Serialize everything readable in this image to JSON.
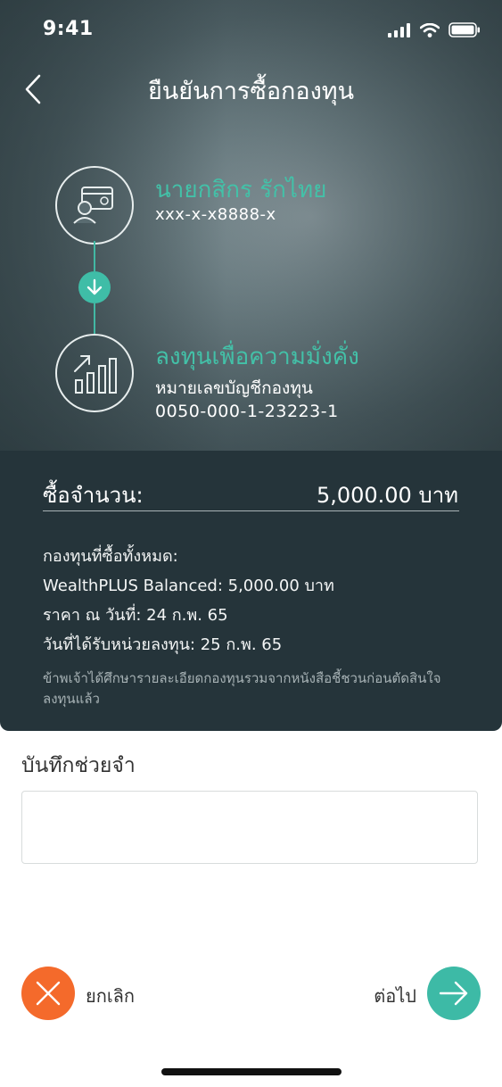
{
  "status_bar": {
    "time": "9:41"
  },
  "header": {
    "title": "ยืนยันการซื้อกองทุน"
  },
  "source_account": {
    "name": "นายกสิกร รักไทย",
    "number": "xxx-x-x8888-x"
  },
  "destination_fund": {
    "name": "ลงทุนเพื่อความมั่งคั่ง",
    "label": "หมายเลขบัญชีกองทุน",
    "number": "0050-000-1-23223-1"
  },
  "summary": {
    "amount_label": "ซื้อจำนวน:",
    "amount_value": "5,000.00 บาท",
    "details": [
      "กองทุนที่ซื้อทั้งหมด:",
      "WealthPLUS Balanced: 5,000.00 บาท",
      "ราคา ณ วันที่: 24 ก.พ. 65",
      "วันที่ได้รับหน่วยลงทุน: 25 ก.พ. 65"
    ],
    "disclaimer": "ข้าพเจ้าได้ศึกษารายละเอียดกองทุนรวมจากหนังสือชี้ชวนก่อนตัดสินใจลงทุนแล้ว"
  },
  "memo": {
    "label": "บันทึกช่วยจำ",
    "value": "",
    "placeholder": ""
  },
  "actions": {
    "cancel_label": "ยกเลิก",
    "next_label": "ต่อไป"
  },
  "colors": {
    "accent": "#43c1a8",
    "cancel": "#f46a2b",
    "next": "#3dbaa6",
    "panel": "#25343a"
  },
  "icons": [
    "signal-icon",
    "wifi-icon",
    "battery-icon",
    "back-chevron-icon",
    "user-card-icon",
    "arrow-down-icon",
    "growth-chart-icon",
    "close-icon",
    "arrow-right-icon"
  ]
}
